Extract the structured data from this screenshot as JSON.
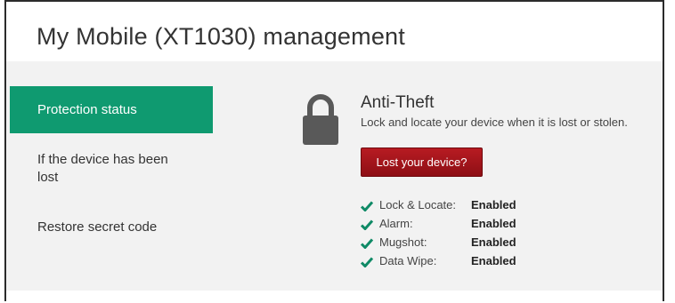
{
  "header": {
    "title": "My Mobile (XT1030) management"
  },
  "sidebar": {
    "items": [
      {
        "label": "Protection status"
      },
      {
        "label": "If the device has been lost"
      },
      {
        "label": "Restore secret code"
      }
    ]
  },
  "main": {
    "icon": "lock-icon",
    "title": "Anti-Theft",
    "description": "Lock and locate your device when it is lost or stolen.",
    "button_label": "Lost your device?",
    "features": [
      {
        "label": "Lock & Locate:",
        "status": "Enabled"
      },
      {
        "label": "Alarm:",
        "status": "Enabled"
      },
      {
        "label": "Mugshot:",
        "status": "Enabled"
      },
      {
        "label": "Data Wipe:",
        "status": "Enabled"
      }
    ]
  },
  "colors": {
    "accent": "#0f9a70",
    "button": "#a8141c",
    "check": "#0f8a66",
    "content_bg": "#f2f2f2"
  }
}
